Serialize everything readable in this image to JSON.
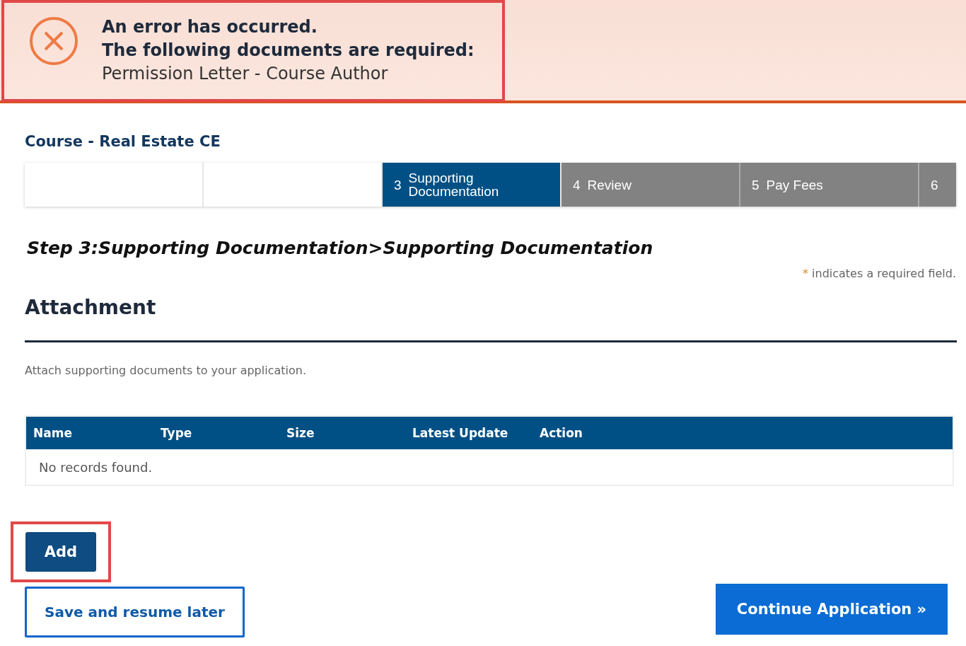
{
  "error_banner": {
    "highlighted": true,
    "title": "An error has occurred.",
    "subtitle": "The following documents are required:",
    "documents": [
      "Permission Letter - Course Author"
    ]
  },
  "course_title": "Course - Real Estate CE",
  "steps": [
    {
      "kind": "blank"
    },
    {
      "kind": "blank"
    },
    {
      "kind": "current",
      "number": "3",
      "label": "Supporting Documentation"
    },
    {
      "kind": "upcoming",
      "number": "4",
      "label": "Review"
    },
    {
      "kind": "upcoming",
      "number": "5",
      "label": "Pay Fees"
    },
    {
      "kind": "upcoming",
      "number": "6"
    }
  ],
  "step_heading": {
    "step": "Step 3:",
    "section": "Supporting Documentation",
    "separator": ">",
    "page": "Supporting Documentation"
  },
  "required_note": {
    "mark": "*",
    "text": "indicates a required field."
  },
  "section_title": "Attachment",
  "instructions": "Attach supporting documents to your application.",
  "table": {
    "columns": [
      "Name",
      "Type",
      "Size",
      "Latest Update",
      "Action"
    ],
    "empty_message": "No records found."
  },
  "add_button": {
    "label": "Add",
    "highlighted": true
  },
  "save_button": "Save and resume later",
  "continue_button": "Continue Application »"
}
